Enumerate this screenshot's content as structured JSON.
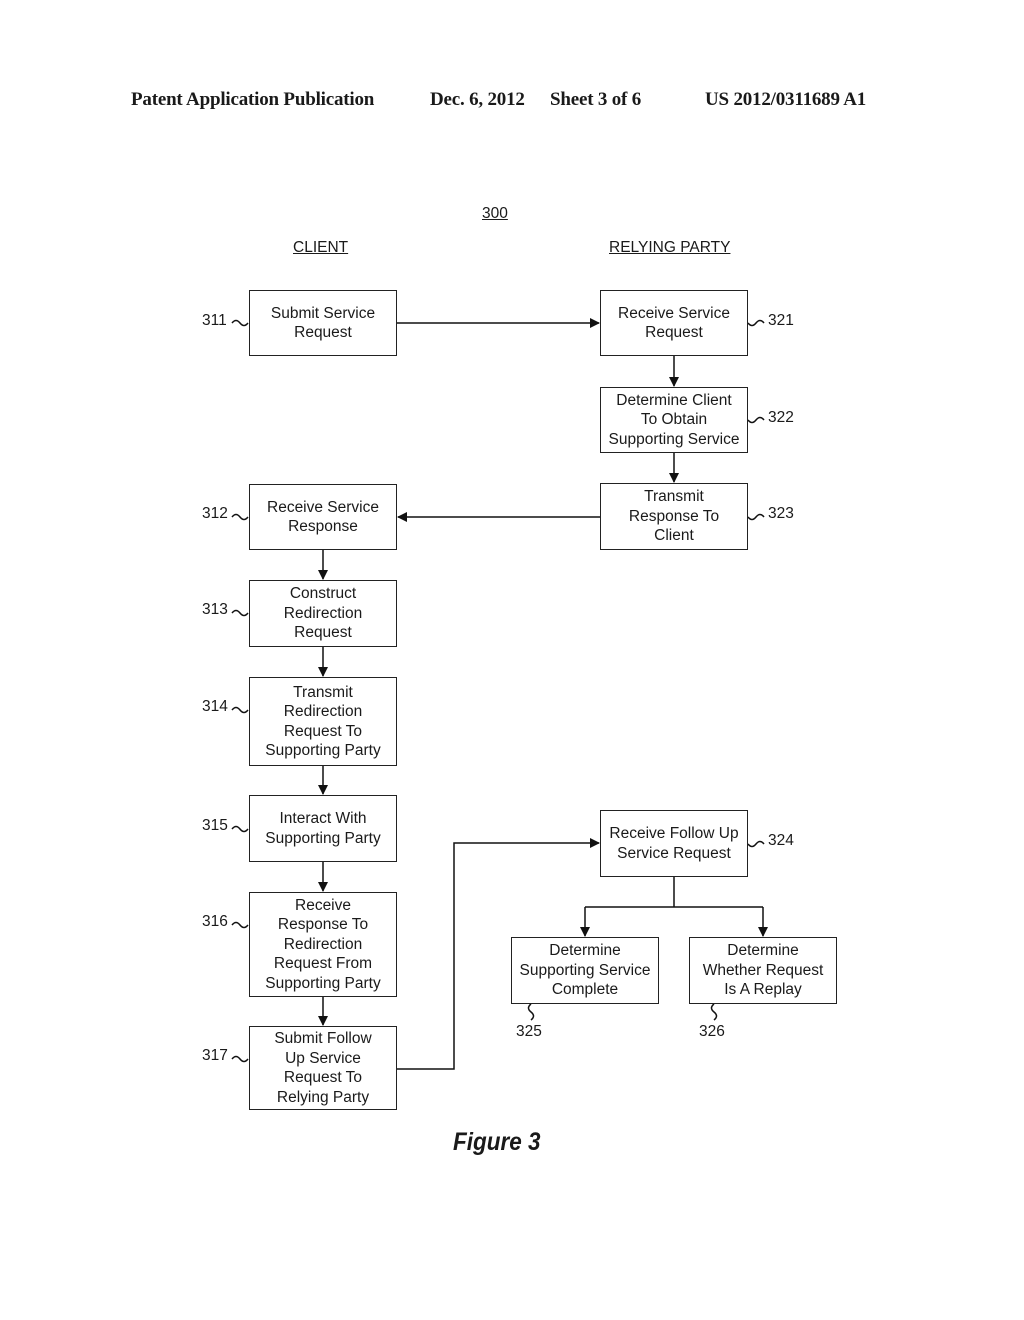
{
  "header": {
    "publication": "Patent Application Publication",
    "date": "Dec. 6, 2012",
    "sheet": "Sheet 3 of 6",
    "number": "US 2012/0311689 A1"
  },
  "diagram": {
    "ref": "300",
    "columns": {
      "client": "CLIENT",
      "relying_party": "RELYING PARTY"
    },
    "client_steps": [
      {
        "ref": "311",
        "label": "Submit Service\nRequest"
      },
      {
        "ref": "312",
        "label": "Receive Service\nResponse"
      },
      {
        "ref": "313",
        "label": "Construct\nRedirection\nRequest"
      },
      {
        "ref": "314",
        "label": "Transmit\nRedirection\nRequest To\nSupporting Party"
      },
      {
        "ref": "315",
        "label": "Interact With\nSupporting Party"
      },
      {
        "ref": "316",
        "label": "Receive\nResponse To\nRedirection\nRequest From\nSupporting Party"
      },
      {
        "ref": "317",
        "label": "Submit Follow\nUp Service\nRequest To\nRelying Party"
      }
    ],
    "relying_party_steps": [
      {
        "ref": "321",
        "label": "Receive Service\nRequest"
      },
      {
        "ref": "322",
        "label": "Determine Client\nTo Obtain\nSupporting Service"
      },
      {
        "ref": "323",
        "label": "Transmit\nResponse To\nClient"
      },
      {
        "ref": "324",
        "label": "Receive Follow Up\nService Request"
      },
      {
        "ref": "325",
        "label": "Determine\nSupporting Service\nComplete"
      },
      {
        "ref": "326",
        "label": "Determine\nWhether Request\nIs A Replay"
      }
    ],
    "figure_label": "Figure 3"
  }
}
